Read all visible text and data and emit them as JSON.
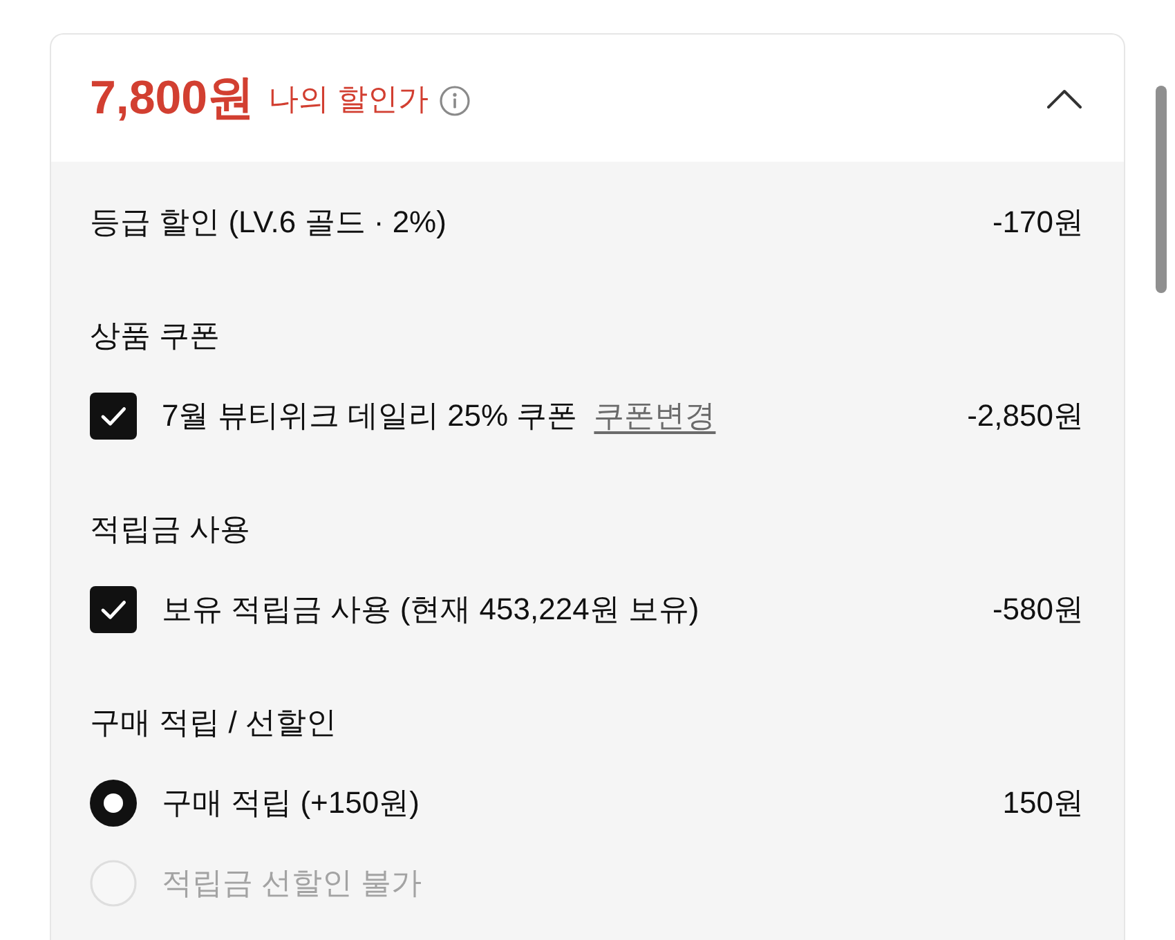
{
  "summary": {
    "price": "7,800원",
    "label": "나의 할인가",
    "expanded": true
  },
  "discounts": [
    {
      "kind": "line",
      "label": "등급 할인 (LV.6 골드 · 2%)",
      "amount": "-170원"
    },
    {
      "kind": "group",
      "title": "상품 쿠폰",
      "options": [
        {
          "kind": "checkbox",
          "label": "7월 뷰티위크 데일리 25% 쿠폰",
          "link": "쿠폰변경",
          "checked": true,
          "amount": "-2,850원"
        }
      ]
    },
    {
      "kind": "group",
      "title": "적립금 사용",
      "options": [
        {
          "kind": "checkbox",
          "label": "보유 적립금 사용 (현재 453,224원 보유)",
          "checked": true,
          "amount": "-580원"
        }
      ]
    },
    {
      "kind": "group",
      "title": "구매 적립 / 선할인",
      "options": [
        {
          "kind": "radio",
          "label": "구매 적립 (+150원)",
          "selected": true,
          "disabled": false,
          "amount": "150원"
        },
        {
          "kind": "radio",
          "label": "적립금 선할인 불가",
          "selected": false,
          "disabled": true
        }
      ]
    }
  ]
}
